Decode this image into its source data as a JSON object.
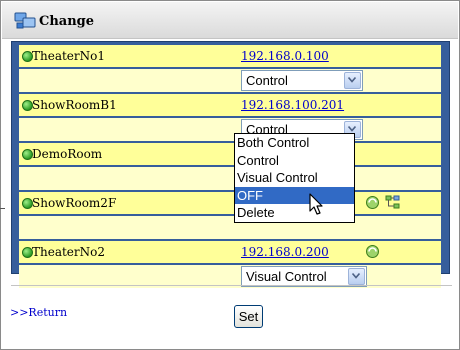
{
  "header": {
    "title": "Change",
    "icon": "devices-icon"
  },
  "rows": [
    {
      "name": "TheaterNo1",
      "ip": "192.168.0.100",
      "mode": "Control"
    },
    {
      "name": "ShowRoomB1",
      "ip": "192.168.100.201",
      "mode": "Control"
    },
    {
      "name": "DemoRoom"
    },
    {
      "name": "ShowRoom2F"
    },
    {
      "name": "TheaterNo2",
      "ip": "192.168.0.200",
      "mode": "Visual Control"
    }
  ],
  "dropdown": {
    "options": [
      "Both Control",
      "Control",
      "Visual Control",
      "OFF",
      "Delete"
    ],
    "highlighted": "OFF"
  },
  "footer": {
    "return_label": ">>Return",
    "set_label": "Set"
  },
  "colors": {
    "panel": "#365e9c",
    "row": "#ffff99",
    "row_alt": "#ffffcc",
    "link": "#0000cc",
    "highlight": "#316ac5",
    "status_online": "#2c9c25"
  }
}
